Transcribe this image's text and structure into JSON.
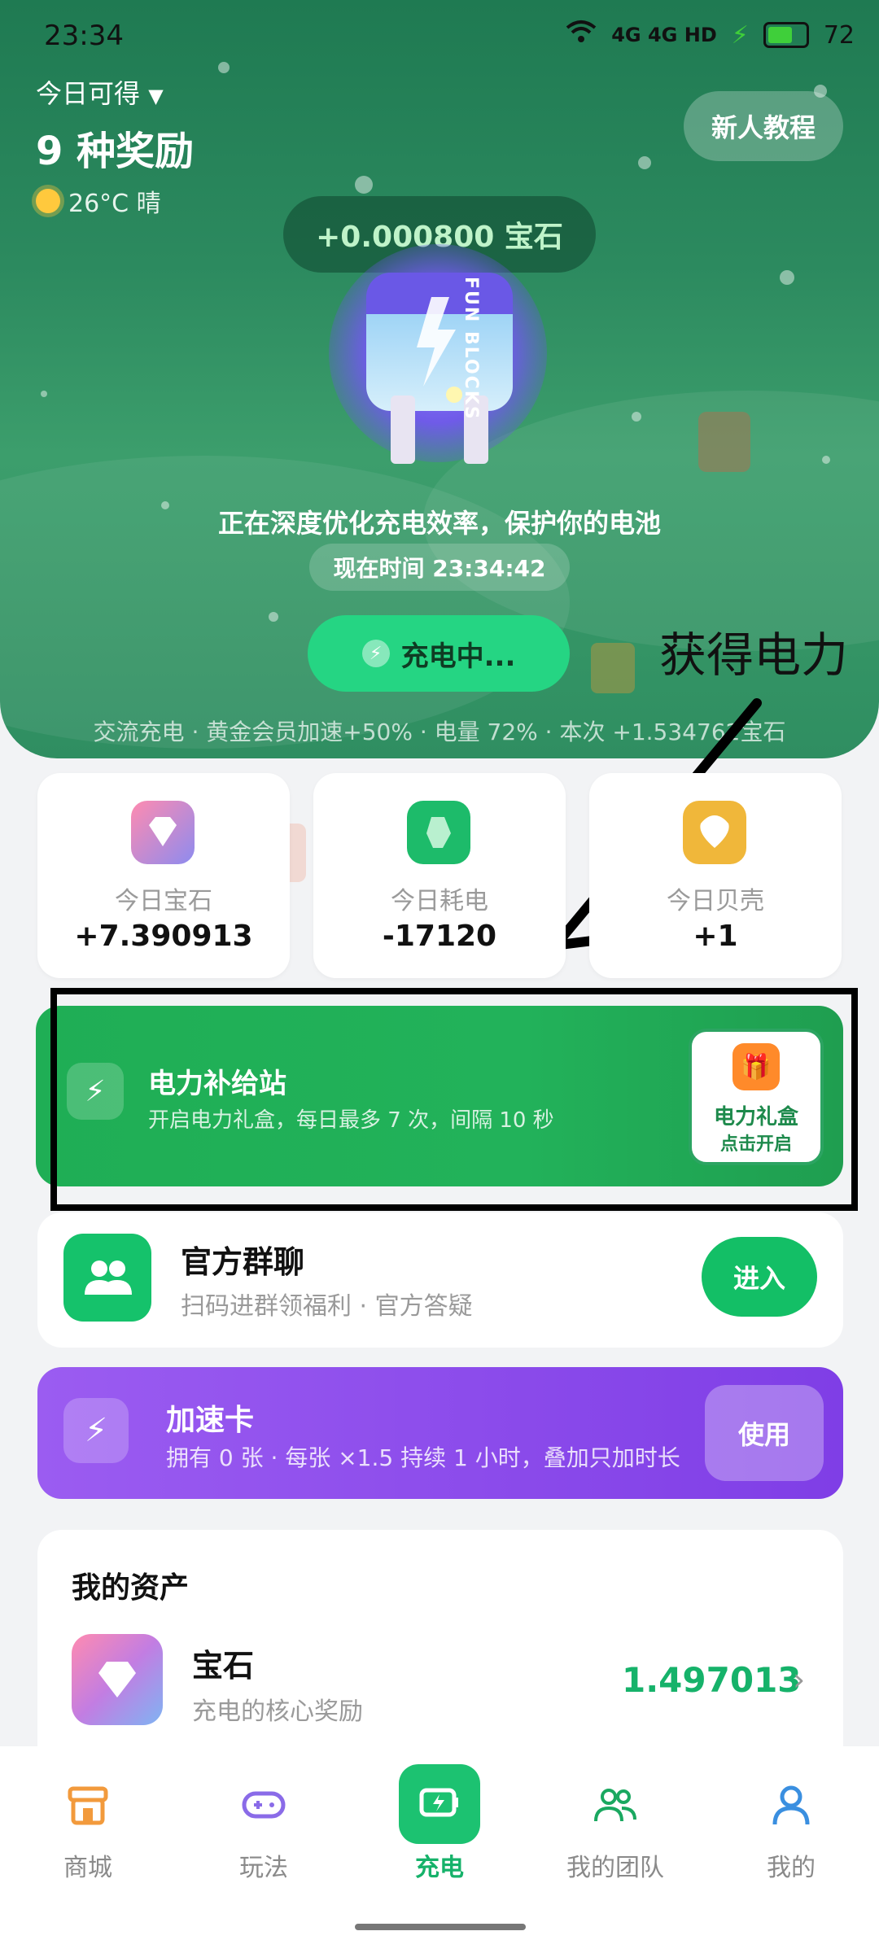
{
  "status_bar": {
    "time": "23:34",
    "signal_text": "4G 4G HD",
    "battery": 72
  },
  "header": {
    "today_available": "今日可得",
    "reward_count": "9 种奖励",
    "weather": "26°C 晴",
    "tutorial_button": "新人教程",
    "gem_earning": "+0.000800 宝石",
    "battery_brand": "FUN BLOCKS",
    "optimize_text": "正在深度优化充电效率，保护你的电池",
    "current_time": "现在时间 23:34:42",
    "charging_button": "充电中...",
    "summary": "交流充电 · 黄金会员加速+50% · 电量 72% · 本次 +1.534762宝石"
  },
  "annotation": {
    "text": "获得电力"
  },
  "stats": [
    {
      "label": "今日宝石",
      "value": "+7.390913",
      "color": "#b27ee6"
    },
    {
      "label": "今日耗电",
      "value": "-17120",
      "color": "#1dbb6a"
    },
    {
      "label": "今日贝壳",
      "value": "+1",
      "color": "#f0b73a"
    }
  ],
  "power_station": {
    "title": "电力补给站",
    "subtitle": "开启电力礼盒，每日最多 7 次，间隔 10 秒",
    "gift_title": "电力礼盒",
    "gift_action": "点击开启"
  },
  "group_chat": {
    "title": "官方群聊",
    "subtitle": "扫码进群领福利 · 官方答疑",
    "button": "进入"
  },
  "speed_card": {
    "title": "加速卡",
    "subtitle": "拥有 0 张 · 每张 ×1.5 持续 1 小时，叠加只加时长",
    "button": "使用"
  },
  "assets": {
    "title": "我的资产",
    "items": [
      {
        "name": "宝石",
        "desc": "充电的核心奖励",
        "value": "1.497013"
      }
    ]
  },
  "nav": {
    "items": [
      {
        "label": "商城",
        "icon": "store-icon"
      },
      {
        "label": "玩法",
        "icon": "gamepad-icon"
      },
      {
        "label": "充电",
        "icon": "battery-charge-icon"
      },
      {
        "label": "我的团队",
        "icon": "team-icon"
      },
      {
        "label": "我的",
        "icon": "user-icon"
      }
    ],
    "active_index": 2
  },
  "colors": {
    "accent": "#16b26a",
    "speed": "#8a4ae8",
    "header": "#2c8a5f"
  }
}
